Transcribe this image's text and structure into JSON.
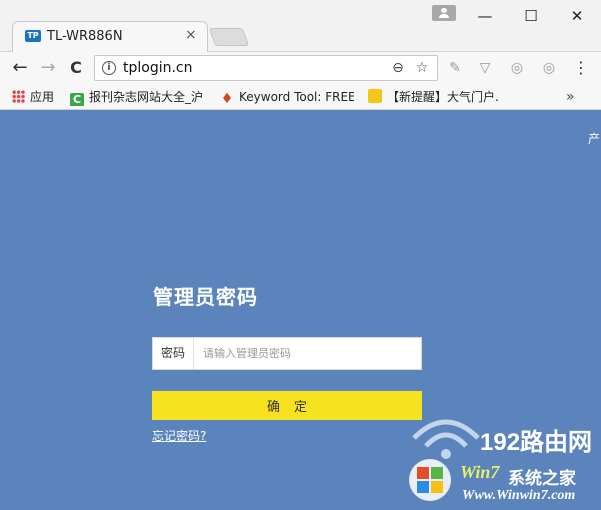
{
  "browser": {
    "tab": {
      "favicon_text": "TP",
      "title": "TL-WR886N",
      "close": "×"
    },
    "window_controls": {
      "minimize": "—",
      "maximize": "☐",
      "close": "✕"
    },
    "nav": {
      "back": "←",
      "forward": "→",
      "reload": "C",
      "menu": "⋮"
    },
    "address_bar": {
      "url": "tplogin.cn",
      "info": "i",
      "zoom": "⊖",
      "star": "☆"
    },
    "extensions": [
      "extension-icon",
      "shield-icon",
      "extension-icon",
      "extension-icon"
    ],
    "bookmarks": [
      {
        "label": "应用",
        "icon": "apps-grid-icon"
      },
      {
        "label": "报刊杂志网站大全_沪",
        "icon": "green-c-icon",
        "icon_text": "C"
      },
      {
        "label": "Keyword Tool: FREE",
        "icon": "fire-icon",
        "icon_text": "♦"
      },
      {
        "label": "【新提醒】大气门户.",
        "icon": "yellow-badge-icon"
      }
    ],
    "bookmarks_more": "»"
  },
  "page": {
    "background_color": "#5b84bd",
    "lang_link": "产",
    "title": "管理员密码",
    "password_label": "密码",
    "password_placeholder": "请输入管理员密码",
    "confirm_label": "确定",
    "forgot_link": "忘记密码?",
    "accent_color": "#f6e21f"
  },
  "watermark": {
    "text_192": "192路由网",
    "win7_brand": "Win7",
    "site_name": "系统之家",
    "url": "Www.Winwin7.com"
  }
}
